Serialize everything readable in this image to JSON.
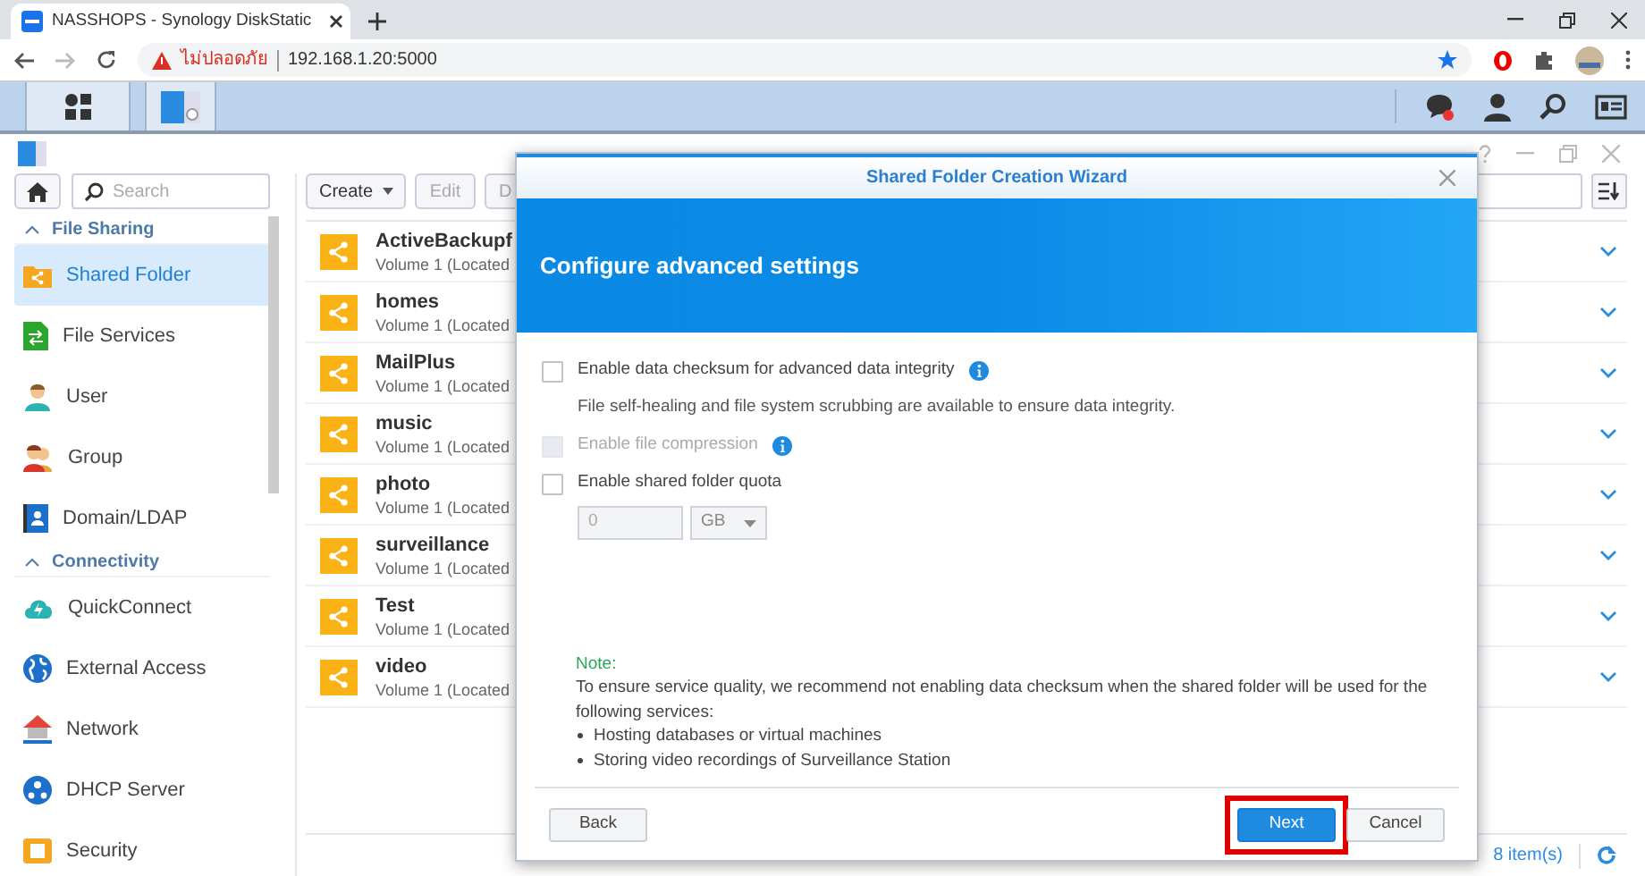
{
  "browser": {
    "tab_title": "NASSHOPS - Synology DiskStatic",
    "address": {
      "warning": "ไม่ปลอดภัย",
      "url": "192.168.1.20:5000"
    }
  },
  "sidebar": {
    "search": {
      "placeholder": "Search"
    },
    "sections": [
      {
        "title": "File Sharing",
        "expanded": true,
        "items": [
          {
            "label": "Shared Folder",
            "selected": true
          },
          {
            "label": "File Services",
            "selected": false
          },
          {
            "label": "User",
            "selected": false
          },
          {
            "label": "Group",
            "selected": false
          },
          {
            "label": "Domain/LDAP",
            "selected": false
          }
        ]
      },
      {
        "title": "Connectivity",
        "expanded": true,
        "items": [
          {
            "label": "QuickConnect",
            "selected": false
          },
          {
            "label": "External Access",
            "selected": false
          },
          {
            "label": "Network",
            "selected": false
          },
          {
            "label": "DHCP Server",
            "selected": false
          },
          {
            "label": "Security",
            "selected": false
          }
        ]
      }
    ]
  },
  "toolbar": [
    {
      "label": "Create",
      "dropdown": true,
      "disabled": false
    },
    {
      "label": "Edit",
      "dropdown": false,
      "disabled": true
    },
    {
      "label": "D",
      "dropdown": false,
      "disabled": true
    }
  ],
  "folders": [
    {
      "name": "ActiveBackupf",
      "location": "Volume 1 (Located"
    },
    {
      "name": "homes",
      "location": "Volume 1 (Located"
    },
    {
      "name": "MailPlus",
      "location": "Volume 1 (Located"
    },
    {
      "name": "music",
      "location": "Volume 1 (Located"
    },
    {
      "name": "photo",
      "location": "Volume 1 (Located"
    },
    {
      "name": "surveillance",
      "location": "Volume 1 (Located"
    },
    {
      "name": "Test",
      "location": "Volume 1 (Located"
    },
    {
      "name": "video",
      "location": "Volume 1 (Located"
    }
  ],
  "status_bar": {
    "count": "8 item(s)"
  },
  "dialog": {
    "title": "Shared Folder Creation Wizard",
    "heading": "Configure advanced settings",
    "options": [
      {
        "kind": "checkbox",
        "label": "Enable data checksum for advanced data integrity",
        "checked": false,
        "disabled": false,
        "info": true
      },
      {
        "kind": "text",
        "label": "File self-healing and file system scrubbing are available to ensure data integrity."
      },
      {
        "kind": "checkbox",
        "label": "Enable file compression",
        "checked": false,
        "disabled": true,
        "info": true
      },
      {
        "kind": "checkbox",
        "label": "Enable shared folder quota",
        "checked": false,
        "disabled": false,
        "info": false
      },
      {
        "kind": "quota",
        "value": "0",
        "unit": "GB",
        "disabled": true
      }
    ],
    "note": {
      "title": "Note:",
      "text": "To ensure service quality, we recommend not enabling data checksum when the shared folder will be used for the following services:",
      "bullets": [
        "Hosting databases or virtual machines",
        "Storing video recordings of Surveillance Station"
      ]
    },
    "buttons": {
      "back": "Back",
      "next": "Next",
      "cancel": "Cancel"
    },
    "next_highlighted": true
  }
}
